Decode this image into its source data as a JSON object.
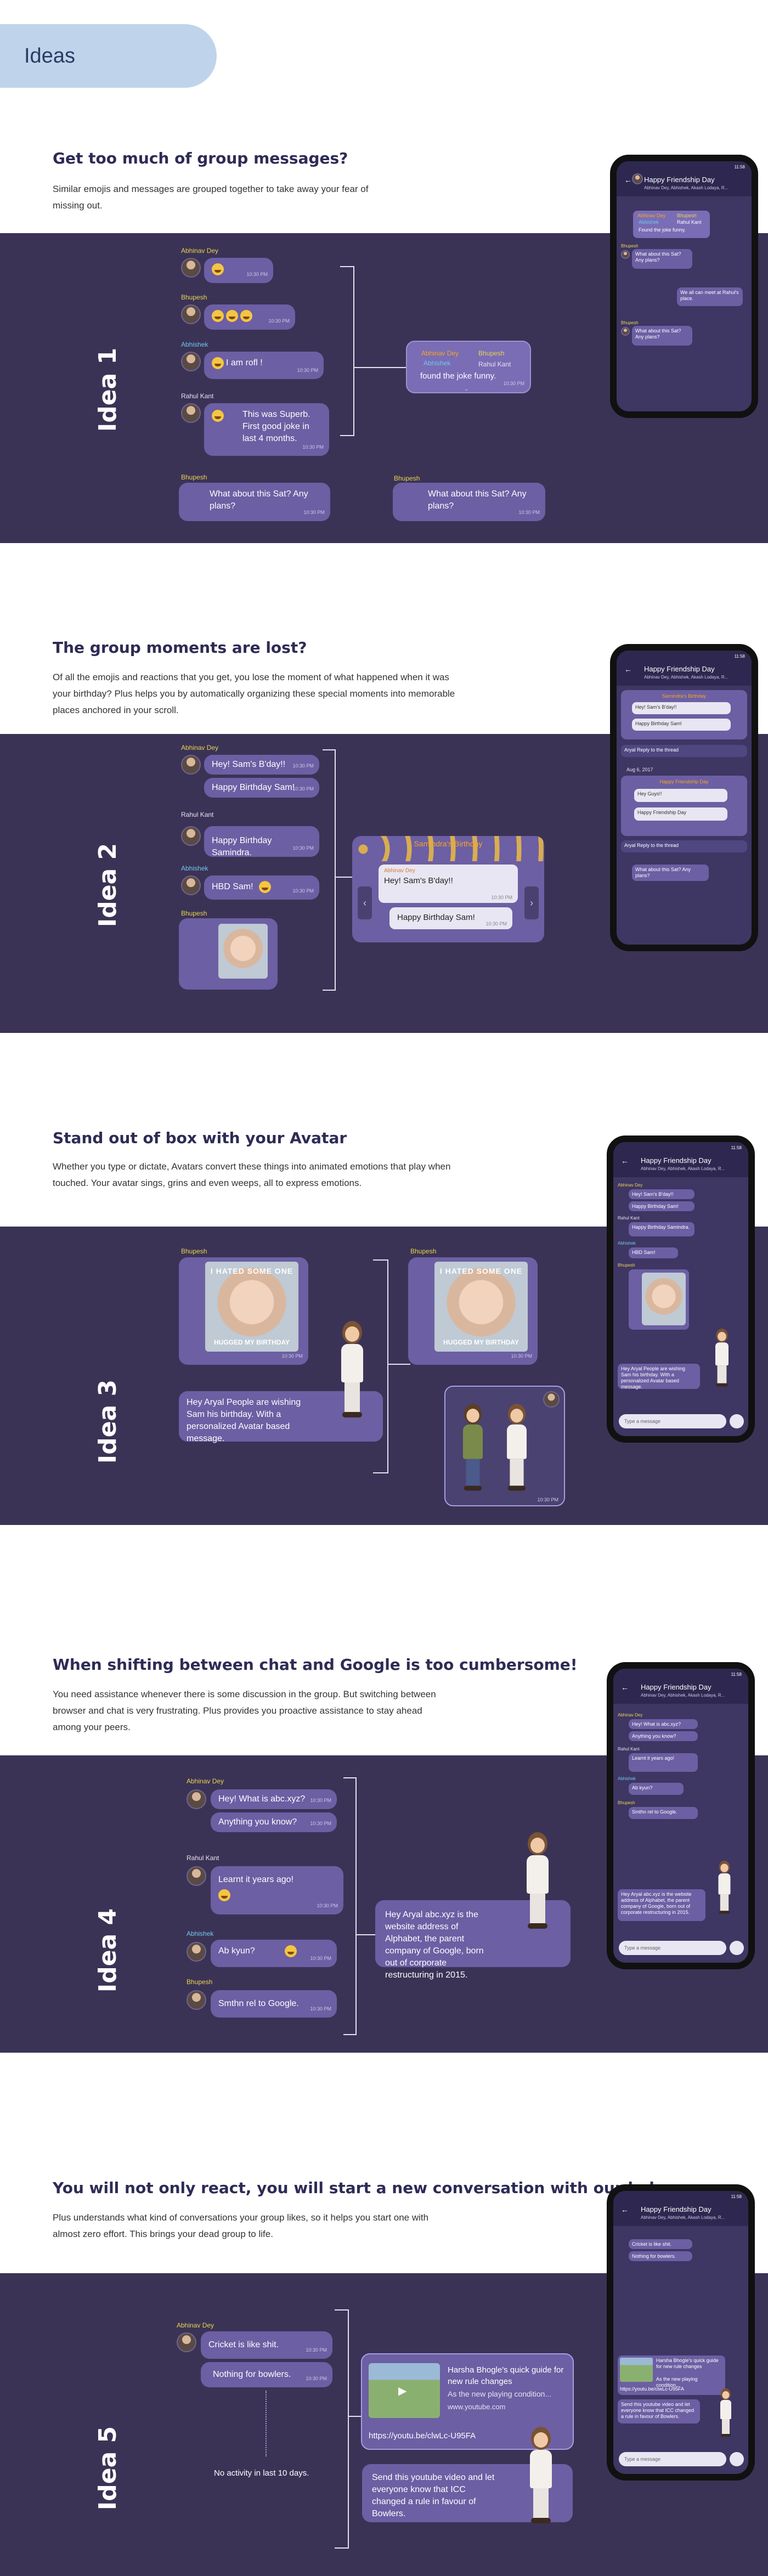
{
  "header": {
    "title": "Ideas"
  },
  "phone_common": {
    "chat_title": "Happy Friendship Day",
    "chat_sub": "Abhinav Dey, Abhishek, Akash Lodaya, R...",
    "type_placeholder": "Type a message",
    "status_time": "11:58"
  },
  "idea1": {
    "label": "Idea 1",
    "title": "Get too much of group messages?",
    "desc": "Similar emojis and messages are grouped together to take away your fear of missing out.",
    "names": {
      "a": "Abhinav Dey",
      "b": "Bhupesh",
      "c": "Abhishek",
      "d": "Rahul Kant",
      "e": "Bhupesh",
      "f": "Bhupesh"
    },
    "msgs": {
      "rofl": "I am rofl !",
      "superb": "This was Superb. First good joke in last 4 months.",
      "sat": "What about this Sat? Any plans?",
      "time": "10:30 PM"
    },
    "grouped": {
      "n1": "Abhinav Dey",
      "n2": "Bhupesh",
      "n3": "Abhishek",
      "n4": "Rahul Kant",
      "text": "found the joke funny."
    },
    "phone": {
      "g1": "Abhinav Dey",
      "g2": "Bhupesh",
      "g3": "Abhishek",
      "g4": "Rahul Kant",
      "gtext": "Found the joke funny.",
      "n_b": "Bhupesh",
      "sat": "What about this Sat? Any plans?",
      "reply": "We all can meet at Rahul's place.",
      "n_b2": "Bhupesh",
      "sat2": "What about this Sat? Any plans?",
      "time": "10:30 PM"
    }
  },
  "idea2": {
    "label": "Idea 2",
    "title": "The group moments are lost?",
    "desc": "Of all the emojis and reactions that you get, you lose the moment of what happened when it was your birthday? Plus helps you by automatically organizing these special moments into memorable places anchored in your scroll.",
    "names": {
      "a": "Abhinav Dey",
      "b": "Rahul Kant",
      "c": "Abhishek",
      "d": "Bhupesh"
    },
    "msgs": {
      "hey": "Hey! Sam's B'day!!",
      "hbd": "Happy Birthday Sam!",
      "hbd2": "Happy Birthday Samindra.",
      "hbd3": "HBD Sam!",
      "time": "10:30 PM"
    },
    "moment": {
      "title": "Samindra's Birthday",
      "name": "Abhinav Dey",
      "msg1": "Hey! Sam's B'day!!",
      "msg2": "Happy Birthday Sam!",
      "time": "10:30 PM"
    },
    "phone": {
      "m_title": "Samindra's Birthday",
      "m1": "Hey! Sam's B'day!!",
      "m2": "Happy Birthday Sam!",
      "reply": "Aryal Reply to the thread",
      "date": "Aug 6, 2017",
      "m_title2": "Happy Friendship Day",
      "m3": "Hey Guys!!",
      "m4": "Happy Friendship Day",
      "reply2": "Aryal Reply to the thread",
      "sat": "What about this Sat? Any plans?"
    }
  },
  "idea3": {
    "label": "Idea 3",
    "title": "Stand out of box with your Avatar",
    "desc": "Whether you type or dictate, Avatars convert these things into animated emotions that play when touched. Your avatar sings, grins and even weeps, all to express emotions.",
    "names": {
      "a": "Bhupesh",
      "b": "Bhupesh"
    },
    "meme": {
      "top": "I HATED SOME ONE",
      "bottom": "HUGGED MY BIRTHDAY"
    },
    "msgs": {
      "wish": "Hey Aryal People are wishing Sam his birthday. With a personalized Avatar based message.",
      "time": "10:30 PM"
    },
    "phone": {
      "n1": "Abhinav Dey",
      "m1": "Hey! Sam's B'day!!",
      "m2": "Happy Birthday Sam!",
      "n2": "Rahul Kant",
      "m3": "Happy Birthday Samindra.",
      "n3": "Abhishek",
      "m4": "HBD Sam!",
      "n4": "Bhupesh",
      "wish": "Hey Aryal People are wishing Sam his birthday. With a personalized Avatar based message."
    }
  },
  "idea4": {
    "label": "Idea 4",
    "title": "When shifting between chat and Google is too cumbersome!",
    "desc": "You need assistance whenever there is some discussion in the group. But switching between browser and chat is very frustrating. Plus provides you proactive assistance to stay ahead among your peers.",
    "names": {
      "a": "Abhinav Dey",
      "b": "Rahul Kant",
      "c": "Abhishek",
      "d": "Bhupesh"
    },
    "msgs": {
      "what": "Hey! What is abc.xyz?",
      "know": "Anything you know?",
      "learnt": "Learnt it years ago!",
      "kyun": "Ab kyun?",
      "smthn": "Smthn rel to Google.",
      "time": "10:30 PM"
    },
    "assist": "Hey Aryal abc.xyz is the website address of Alphabet, the parent company of Google, born out of corporate restructuring in 2015.",
    "phone": {
      "n1": "Abhinav Dey",
      "m1": "Hey! What is abc.xyz?",
      "m2": "Anything you know?",
      "n2": "Rahul Kant",
      "m3": "Learnt it years ago!",
      "n3": "Abhishek",
      "m4": "Ab kyun?",
      "n4": "Bhupesh",
      "m5": "Smthn rel to Google.",
      "assist": "Hey Aryal abc.xyz is the website address of Alphabet, the parent company of Google, born out of corporate restructuring in 2015."
    }
  },
  "idea5": {
    "label": "Idea 5",
    "title": "You will not only react, you will start a new conversation with our help.",
    "desc": "Plus understands what kind of conversations your group likes, so it helps you start one with almost zero effort. This brings your dead group to life.",
    "names": {
      "a": "Abhinav Dey"
    },
    "msgs": {
      "cricket": "Cricket is like shit.",
      "nothing": "Nothing for bowlers.",
      "inactive": "No activity in last 10 days.",
      "time": "10:30 PM"
    },
    "video": {
      "title": "Harsha Bhogle's quick guide for new rule changes",
      "desc": "As the new playing condition...",
      "site": "www.youtube.com",
      "link": "https://youtu.be/clwLc-U95FA"
    },
    "suggest": "Send this youtube video and let everyone know that ICC changed a rule in favour of Bowlers.",
    "phone": {
      "m1": "Cricket is like shit.",
      "m2": "Nothing for bowlers.",
      "vtitle": "Harsha Bhogle's quick guide for new rule changes",
      "vdesc": "As the new playing condition...",
      "link": "https://youtu.be/clwLc-U95FA",
      "suggest": "Send this youtube video and let everyone know that ICC changed a rule in favour of Bowlers."
    }
  }
}
